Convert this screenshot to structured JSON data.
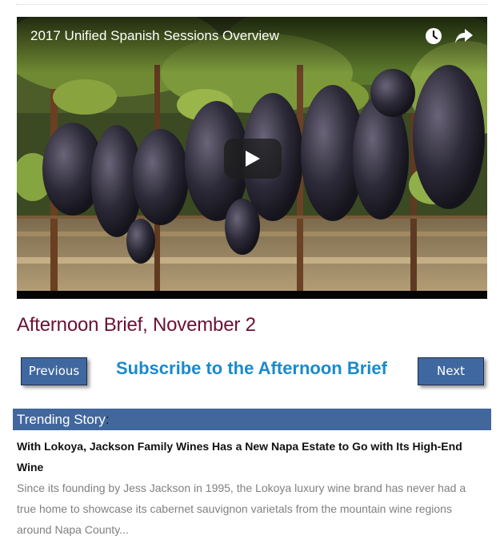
{
  "video": {
    "title": "2017 Unified Spanish Sessions Overview",
    "icons": [
      "clock-icon",
      "share-icon",
      "play-icon"
    ]
  },
  "page": {
    "headline": "Afternoon Brief, November 2"
  },
  "nav": {
    "previous_label": "Previous",
    "subscribe_label": "Subscribe to the Afternoon Brief",
    "next_label": "Next"
  },
  "trending": {
    "label": "Trending Story",
    "colon": ":",
    "story_title": "With Lokoya, Jackson Family Wines Has a New Napa Estate to Go with Its High-End Wine",
    "excerpt": "Since its founding by Jess Jackson in 1995, the Lokoya luxury wine brand has never had a true home to showcase its cabernet sauvignon varietals from the mountain wine regions around Napa County..."
  },
  "colors": {
    "headline": "#6b1132",
    "button": "#4068a0",
    "link": "#1a8acb",
    "trending_bar": "#41679c",
    "excerpt": "#808080"
  }
}
